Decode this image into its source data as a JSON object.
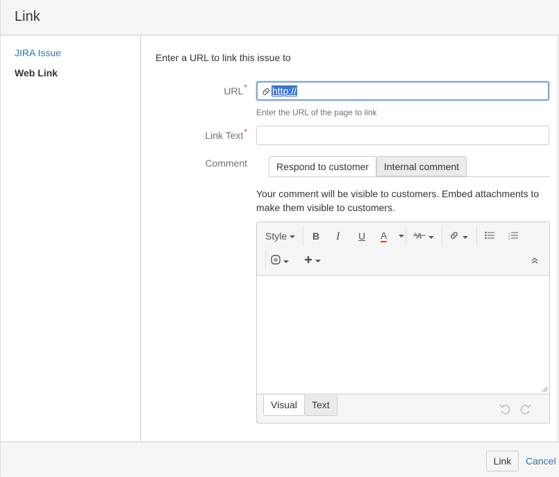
{
  "dialog": {
    "title": "Link"
  },
  "sidebar": {
    "items": [
      {
        "label": "JIRA Issue"
      },
      {
        "label": "Web Link"
      }
    ]
  },
  "form": {
    "intro": "Enter a URL to link this issue to",
    "url": {
      "label": "URL",
      "required": "*",
      "value": "http://",
      "hint": "Enter the URL of the page to link"
    },
    "link_text": {
      "label": "Link Text",
      "required": "*",
      "value": ""
    },
    "comment": {
      "label": "Comment",
      "tabs": [
        {
          "label": "Respond to customer"
        },
        {
          "label": "Internal comment"
        }
      ],
      "note": "Your comment will be visible to customers. Embed attachments to make them visible to customers."
    }
  },
  "editor": {
    "toolbar": {
      "style_label": "Style",
      "bold": "B",
      "italic": "I",
      "underline": "U",
      "color": "A"
    },
    "modes": [
      {
        "label": "Visual"
      },
      {
        "label": "Text"
      }
    ]
  },
  "footer": {
    "link_label": "Link",
    "cancel_label": "Cancel"
  },
  "colors": {
    "accent": "#3572b0",
    "required": "#d04437",
    "selection": "#3875d7"
  }
}
